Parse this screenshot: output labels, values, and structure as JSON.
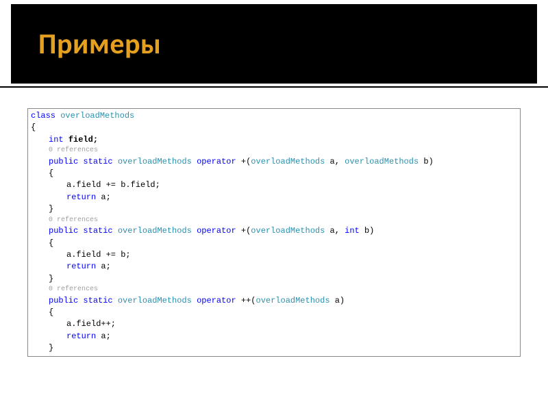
{
  "slide": {
    "title": "Примеры"
  },
  "code": {
    "classKw": "class",
    "className": "overloadMethods",
    "openBrace": "{",
    "closeBrace": "}",
    "intKw": "int",
    "fieldDecl": "field;",
    "codelens": "0 references",
    "publicKw": "public",
    "staticKw": "static",
    "operatorKw": "operator",
    "plusOp": " +(",
    "plusPlusOp": " ++(",
    "paramSep": " a, ",
    "paramEndA": " a)",
    "paramEndB": " b)",
    "intParamB": "int",
    "space": " ",
    "opBodyOpen": "{",
    "line1": "a.field += b.field;",
    "returnKw": "return",
    "returnA": " a;",
    "opBodyClose": "}",
    "line2": "a.field += b;",
    "line3": "a.field++;"
  }
}
